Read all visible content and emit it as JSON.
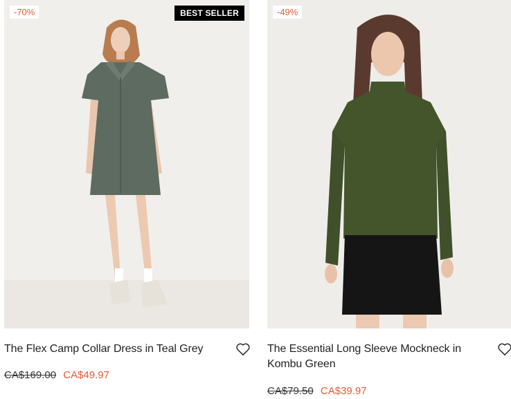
{
  "products": [
    {
      "title": "The Flex Camp Collar Dress in Teal Grey",
      "discount_badge": "-70%",
      "best_seller_badge": "BEST SELLER",
      "original_price": "CA$169.00",
      "sale_price": "CA$49.97",
      "image_icon": "dress-model-image",
      "wishlist_icon": "heart-icon"
    },
    {
      "title": "The Essential Long Sleeve Mockneck in Kombu Green",
      "discount_badge": "-49%",
      "original_price": "CA$79.50",
      "sale_price": "CA$39.97",
      "image_icon": "mockneck-model-image",
      "wishlist_icon": "heart-icon"
    }
  ],
  "colors": {
    "sale": "#e85a36",
    "badge_dark": "#000000",
    "dress": "#5e6b61",
    "top": "#44552b"
  }
}
